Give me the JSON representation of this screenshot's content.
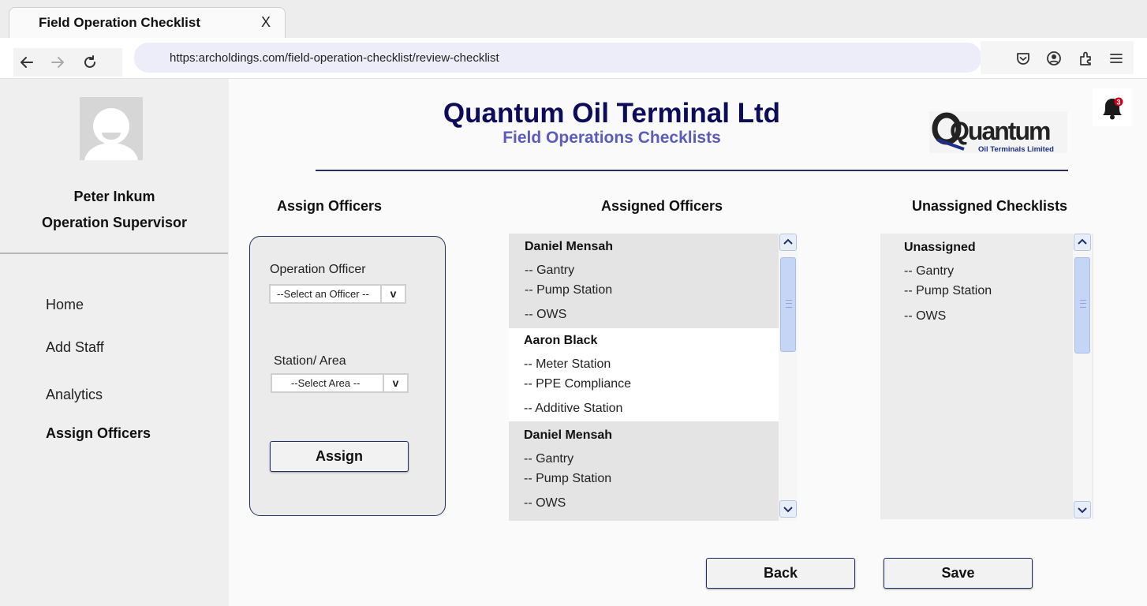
{
  "browser": {
    "tab_title": "Field Operation Checklist",
    "tab_close": "X",
    "url": "https:archoldings.com/field-operation-checklist/review-checklist"
  },
  "sidebar": {
    "user_name": "Peter Inkum",
    "user_role": "Operation Supervisor",
    "nav": [
      {
        "label": "Home",
        "active": false
      },
      {
        "label": "Add Staff",
        "active": false
      },
      {
        "label": "Analytics",
        "active": false
      },
      {
        "label": "Assign Officers",
        "active": true
      }
    ]
  },
  "header": {
    "company": "Quantum Oil Terminal Ltd",
    "subtitle": "Field Operations Checklists",
    "logo_text": "Quantum",
    "logo_subtext": "Oil Terminals Limited",
    "notification_count": "3"
  },
  "assign": {
    "heading": "Assign Officers",
    "officer_label": "Operation Officer",
    "officer_select": "--Select an Officer --",
    "area_label": "Station/ Area",
    "area_select": "--Select Area --",
    "dropdown_glyph": "v",
    "assign_button": "Assign"
  },
  "assigned": {
    "heading": "Assigned Officers",
    "groups": [
      {
        "name": "Daniel Mensah",
        "items": [
          "-- Gantry",
          "-- Pump Station",
          "-- OWS"
        ]
      },
      {
        "name": "Aaron Black",
        "items": [
          "-- Meter Station",
          "-- PPE Compliance",
          "-- Additive Station"
        ]
      },
      {
        "name": "Daniel Mensah",
        "items": [
          "-- Gantry",
          "-- Pump Station",
          "-- OWS"
        ]
      }
    ]
  },
  "unassigned": {
    "heading": "Unassigned Checklists",
    "group_name": "Unassigned",
    "items": [
      "-- Gantry",
      "-- Pump Station",
      "-- OWS"
    ]
  },
  "footer": {
    "back_button": "Back",
    "save_button": "Save"
  },
  "colors": {
    "company": "#0c0c5a",
    "subtitle": "#5c5cbc",
    "panel_border": "#1f2f6b",
    "badge": "#d0021b"
  }
}
